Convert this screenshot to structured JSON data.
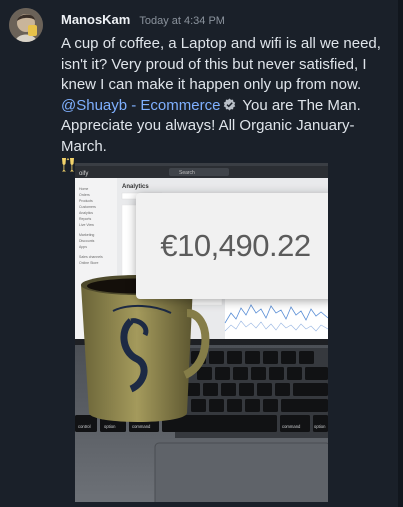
{
  "post": {
    "username": "ManosKam",
    "timestamp": "Today at 4:34 PM",
    "message_part1": "A cup of coffee, a Laptop and wifi is all we need, isn't it? Very proud of this but never satisfied, I knew I can make it happen only up from now.",
    "mention": "@Shuayb - Ecommerce",
    "message_part2": "You are The Man. Appreciate you always! All Organic January-March.",
    "emoji_icon": "clinking-glasses-icon"
  },
  "screenshot": {
    "app_name": "oify",
    "page_title": "Analytics",
    "search_placeholder": "Search",
    "sidebar_items": [
      "Home",
      "Orders",
      "Products",
      "Customers",
      "Analytics",
      "Reports",
      "Live View",
      "Marketing",
      "Discounts",
      "Apps",
      "Sales channels",
      "Online Store"
    ],
    "amount": "€10,490.22",
    "keyboard_keys": [
      "control",
      "option",
      "command",
      "command",
      "option"
    ]
  },
  "colors": {
    "background": "#1a2029",
    "text": "#dfe4ea",
    "mention": "#7fb0ff",
    "timestamp": "#8a929c"
  }
}
